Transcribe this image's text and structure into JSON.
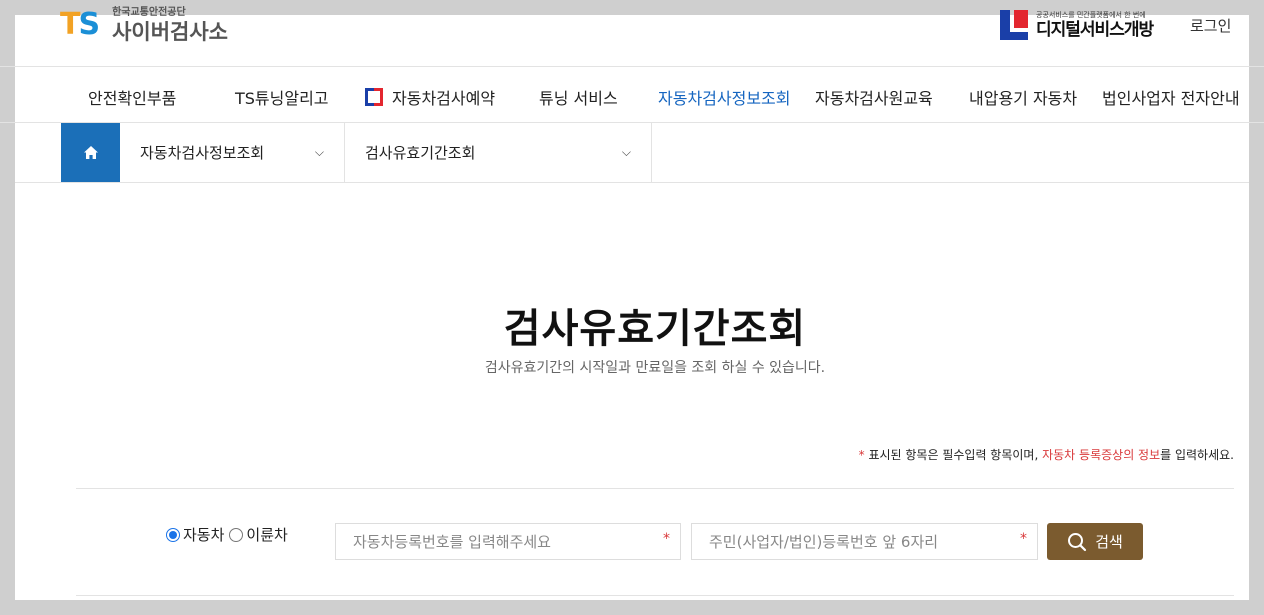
{
  "header": {
    "logo_mark_t": "T",
    "logo_mark_s": "S",
    "org_name": "한국교통안전공단",
    "site_name": "사이버검사소",
    "digital_logo_small": "공공서비스를 민간플랫폼에서 한 번에",
    "digital_logo_big": "디지털서비스개방",
    "login_label": "로그인"
  },
  "gnb": {
    "items": [
      {
        "label": "안전확인부품"
      },
      {
        "label": "TS튜닝알리고"
      },
      {
        "label": "자동차검사예약"
      },
      {
        "label": "튜닝 서비스"
      },
      {
        "label": "자동차검사정보조회"
      },
      {
        "label": "자동차검사원교육"
      },
      {
        "label": "내압용기 자동차"
      },
      {
        "label": "법인사업자 전자안내"
      }
    ],
    "active_index": 4
  },
  "location": {
    "depth1": "자동차검사정보조회",
    "depth2": "검사유효기간조회"
  },
  "main": {
    "title": "검사유효기간조회",
    "subtitle": "검사유효기간의 시작일과 만료일을 조회 하실 수 있습니다.",
    "notice_star": "*",
    "notice_text1": " 표시된 항목은 필수입력 항목이며, ",
    "notice_link": "자동차 등록증상의 정보",
    "notice_text2": "를 입력하세요."
  },
  "form": {
    "radio_car": "자동차",
    "radio_bike": "이륜차",
    "selected": "자동차",
    "reg_number_placeholder": "자동차등록번호를 입력해주세요",
    "id_number_placeholder": "주민(사업자/법인)등록번호 앞 6자리",
    "required_mark": "*",
    "search_label": "검색"
  },
  "colors": {
    "brand_blue": "#1b6fb8",
    "active_menu": "#1565c0",
    "search_button": "#7b5b2f",
    "required": "#d9383a"
  }
}
